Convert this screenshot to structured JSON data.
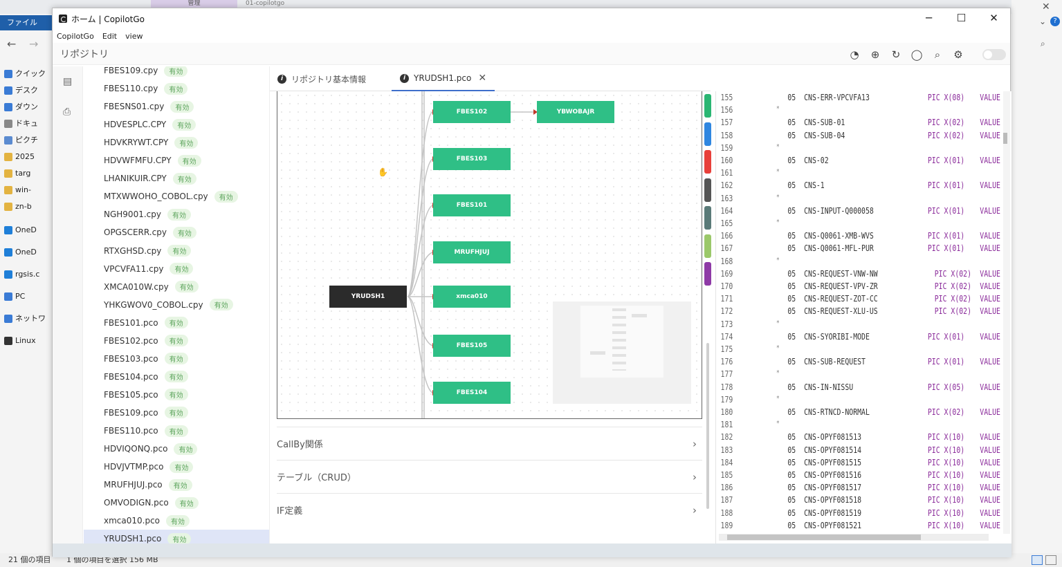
{
  "explorer": {
    "ribbon_label": "ファイル",
    "tab_label": "管理",
    "tab2_label": "01-copilotgo",
    "sidebar": [
      {
        "label": "クイック",
        "color": "#3a7bd5"
      },
      {
        "label": "デスク",
        "color": "#3a7bd5"
      },
      {
        "label": "ダウン",
        "color": "#3a7bd5"
      },
      {
        "label": "ドキュ",
        "color": "#888888"
      },
      {
        "label": "ピクチ",
        "color": "#5b8bd0"
      },
      {
        "label": "2025",
        "color": "#e3b341"
      },
      {
        "label": "targ",
        "color": "#e3b341"
      },
      {
        "label": "win-",
        "color": "#e3b341"
      },
      {
        "label": "zn-b",
        "color": "#e3b341"
      },
      {
        "label": "OneD",
        "color": "#1f7fd8"
      },
      {
        "label": "OneD",
        "color": "#1f7fd8"
      },
      {
        "label": "rgsis.c",
        "color": "#1f7fd8"
      },
      {
        "label": "PC",
        "color": "#3a7bd5"
      },
      {
        "label": "ネットワ",
        "color": "#3a7bd5"
      },
      {
        "label": "Linux",
        "color": "#333333"
      }
    ],
    "status_count": "21 個の項目",
    "status_selected": "1 個の項目を選択  156 MB"
  },
  "window": {
    "title": "ホーム | CopilotGo",
    "menu": [
      "CopilotGo",
      "Edit",
      "view"
    ],
    "section_title": "リポジトリ"
  },
  "files": [
    {
      "name": "FBES109.cpy",
      "status": "有効"
    },
    {
      "name": "FBES110.cpy",
      "status": "有効"
    },
    {
      "name": "FBESNS01.cpy",
      "status": "有効"
    },
    {
      "name": "HDVESPLC.CPY",
      "status": "有効"
    },
    {
      "name": "HDVKRYWT.CPY",
      "status": "有効"
    },
    {
      "name": "HDVWFMFU.CPY",
      "status": "有効"
    },
    {
      "name": "LHANIKUIR.CPY",
      "status": "有効"
    },
    {
      "name": "MTXWWOHO_COBOL.cpy",
      "status": "有効"
    },
    {
      "name": "NGH9001.cpy",
      "status": "有効"
    },
    {
      "name": "OPGSCERR.cpy",
      "status": "有効"
    },
    {
      "name": "RTXGHSD.cpy",
      "status": "有効"
    },
    {
      "name": "VPCVFA11.cpy",
      "status": "有効"
    },
    {
      "name": "XMCA010W.cpy",
      "status": "有効"
    },
    {
      "name": "YHKGWOV0_COBOL.cpy",
      "status": "有効"
    },
    {
      "name": "FBES101.pco",
      "status": "有効"
    },
    {
      "name": "FBES102.pco",
      "status": "有効"
    },
    {
      "name": "FBES103.pco",
      "status": "有効"
    },
    {
      "name": "FBES104.pco",
      "status": "有効"
    },
    {
      "name": "FBES105.pco",
      "status": "有効"
    },
    {
      "name": "FBES109.pco",
      "status": "有効"
    },
    {
      "name": "FBES110.pco",
      "status": "有効"
    },
    {
      "name": "HDVIQONQ.pco",
      "status": "有効"
    },
    {
      "name": "HDVJVTMP.pco",
      "status": "有効"
    },
    {
      "name": "MRUFHJUJ.pco",
      "status": "有効"
    },
    {
      "name": "OMVODIGN.pco",
      "status": "有効"
    },
    {
      "name": "xmca010.pco",
      "status": "有効"
    },
    {
      "name": "YRUDSH1.pco",
      "status": "有効"
    }
  ],
  "tabs": [
    {
      "label": "リポジトリ基本情報"
    },
    {
      "label": "YRUDSH1.pco"
    }
  ],
  "graph": {
    "root": "YRUDSH1",
    "nodes": [
      "FBES102",
      "YBWOBAJR",
      "FBES103",
      "FBES101",
      "MRUFHJUJ",
      "xmca010",
      "FBES105",
      "FBES104"
    ]
  },
  "sections": [
    {
      "label": "CallBy関係"
    },
    {
      "label": "テーブル（CRUD）"
    },
    {
      "label": "IF定義"
    }
  ],
  "color_tags": [
    "#2bb673",
    "#2f86e0",
    "#e8403a",
    "#555555",
    "#5a7a78",
    "#9bc86a",
    "#8e3aa6"
  ],
  "code_lines": [
    {
      "n": "155",
      "star": false,
      "lvl": "05",
      "name": "CNS-ERR-VPCVFA13",
      "pic": "PIC X(08)",
      "val": "VALUE"
    },
    {
      "n": "156",
      "star": true,
      "lvl": "",
      "name": "",
      "pic": "",
      "val": ""
    },
    {
      "n": "157",
      "star": false,
      "lvl": "05",
      "name": "CNS-SUB-01",
      "pic": "PIC X(02)",
      "val": "VALUE"
    },
    {
      "n": "158",
      "star": false,
      "lvl": "05",
      "name": "CNS-SUB-04",
      "pic": "PIC X(02)",
      "val": "VALUE"
    },
    {
      "n": "159",
      "star": true,
      "lvl": "",
      "name": "",
      "pic": "",
      "val": ""
    },
    {
      "n": "160",
      "star": false,
      "lvl": "05",
      "name": "CNS-02",
      "pic": "PIC X(01)",
      "val": "VALUE"
    },
    {
      "n": "161",
      "star": true,
      "lvl": "",
      "name": "",
      "pic": "",
      "val": ""
    },
    {
      "n": "162",
      "star": false,
      "lvl": "05",
      "name": "CNS-1",
      "pic": "PIC X(01)",
      "val": "VALUE"
    },
    {
      "n": "163",
      "star": true,
      "lvl": "",
      "name": "",
      "pic": "",
      "val": ""
    },
    {
      "n": "164",
      "star": false,
      "lvl": "05",
      "name": "CNS-INPUT-Q000058",
      "pic": "PIC X(01)",
      "val": "VALUE"
    },
    {
      "n": "165",
      "star": true,
      "lvl": "",
      "name": "",
      "pic": "",
      "val": ""
    },
    {
      "n": "166",
      "star": false,
      "lvl": "05",
      "name": "CNS-Q0061-XMB-WVS",
      "pic": "PIC X(01)",
      "val": "VALUE"
    },
    {
      "n": "167",
      "star": false,
      "lvl": "05",
      "name": "CNS-Q0061-MFL-PUR",
      "pic": "PIC X(01)",
      "val": "VALUE"
    },
    {
      "n": "168",
      "star": true,
      "lvl": "",
      "name": "",
      "pic": "",
      "val": ""
    },
    {
      "n": "169",
      "star": false,
      "lvl": "05",
      "name": "CNS-REQUEST-VNW-NW",
      "pic": "PIC X(02)",
      "val": "VALUE"
    },
    {
      "n": "170",
      "star": false,
      "lvl": "05",
      "name": "CNS-REQUEST-VPV-ZR",
      "pic": "PIC X(02)",
      "val": "VALUE"
    },
    {
      "n": "171",
      "star": false,
      "lvl": "05",
      "name": "CNS-REQUEST-ZOT-CC",
      "pic": "PIC X(02)",
      "val": "VALUE"
    },
    {
      "n": "172",
      "star": false,
      "lvl": "05",
      "name": "CNS-REQUEST-XLU-US",
      "pic": "PIC X(02)",
      "val": "VALUE"
    },
    {
      "n": "173",
      "star": true,
      "lvl": "",
      "name": "",
      "pic": "",
      "val": ""
    },
    {
      "n": "174",
      "star": false,
      "lvl": "05",
      "name": "CNS-SYORIBI-MODE",
      "pic": "PIC X(01)",
      "val": "VALUE"
    },
    {
      "n": "175",
      "star": true,
      "lvl": "",
      "name": "",
      "pic": "",
      "val": ""
    },
    {
      "n": "176",
      "star": false,
      "lvl": "05",
      "name": "CNS-SUB-REQUEST",
      "pic": "PIC X(01)",
      "val": "VALUE"
    },
    {
      "n": "177",
      "star": true,
      "lvl": "",
      "name": "",
      "pic": "",
      "val": ""
    },
    {
      "n": "178",
      "star": false,
      "lvl": "05",
      "name": "CNS-IN-NISSU",
      "pic": "PIC X(05)",
      "val": "VALUE"
    },
    {
      "n": "179",
      "star": true,
      "lvl": "",
      "name": "",
      "pic": "",
      "val": ""
    },
    {
      "n": "180",
      "star": false,
      "lvl": "05",
      "name": "CNS-RTNCD-NORMAL",
      "pic": "PIC X(02)",
      "val": "VALUE"
    },
    {
      "n": "181",
      "star": true,
      "lvl": "",
      "name": "",
      "pic": "",
      "val": ""
    },
    {
      "n": "182",
      "star": false,
      "lvl": "05",
      "name": "CNS-OPYF081513",
      "pic": "PIC X(10)",
      "val": "VALUE"
    },
    {
      "n": "183",
      "star": false,
      "lvl": "05",
      "name": "CNS-OPYF081514",
      "pic": "PIC X(10)",
      "val": "VALUE"
    },
    {
      "n": "184",
      "star": false,
      "lvl": "05",
      "name": "CNS-OPYF081515",
      "pic": "PIC X(10)",
      "val": "VALUE"
    },
    {
      "n": "185",
      "star": false,
      "lvl": "05",
      "name": "CNS-OPYF081516",
      "pic": "PIC X(10)",
      "val": "VALUE"
    },
    {
      "n": "186",
      "star": false,
      "lvl": "05",
      "name": "CNS-OPYF081517",
      "pic": "PIC X(10)",
      "val": "VALUE"
    },
    {
      "n": "187",
      "star": false,
      "lvl": "05",
      "name": "CNS-OPYF081518",
      "pic": "PIC X(10)",
      "val": "VALUE"
    },
    {
      "n": "188",
      "star": false,
      "lvl": "05",
      "name": "CNS-OPYF081519",
      "pic": "PIC X(10)",
      "val": "VALUE"
    },
    {
      "n": "189",
      "star": false,
      "lvl": "05",
      "name": "CNS-OPYF081521",
      "pic": "PIC X(10)",
      "val": "VALUE"
    }
  ]
}
